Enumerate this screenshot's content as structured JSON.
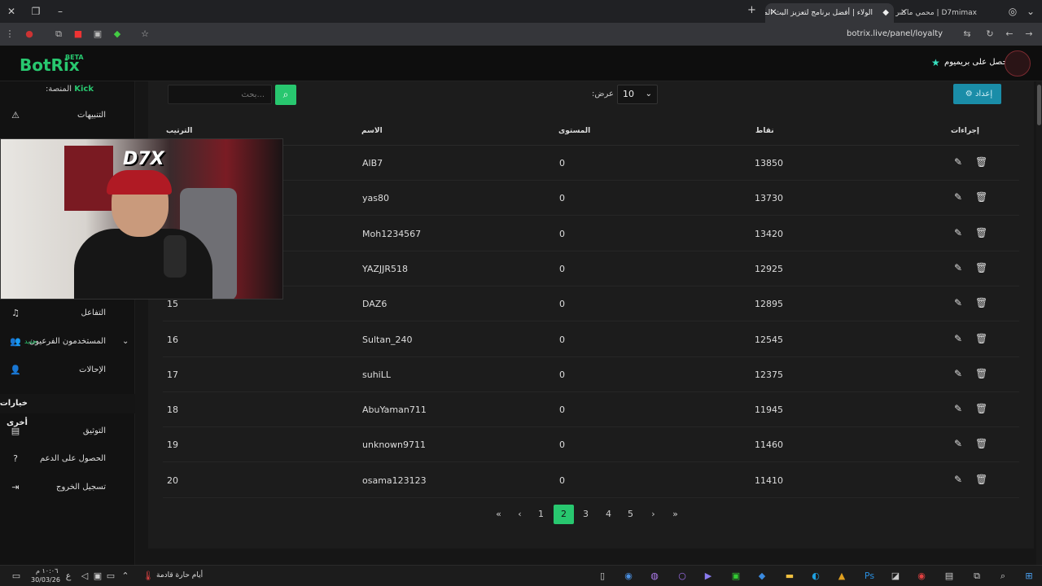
{
  "browser": {
    "tabs": [
      {
        "title": "الولاء | أفضل برنامج لتعزيز البث المباشر",
        "active": true
      },
      {
        "title": "D7mimax | محمي ماكس",
        "active": false
      }
    ],
    "url": "botrix.live/panel/loyalty"
  },
  "header": {
    "logo": "BotRix",
    "logo_badge": "BETA",
    "premium_label": "احصل على بريميوم"
  },
  "sidebar": {
    "platform_label": ":المنصة",
    "platform_value": "Kick",
    "items": [
      {
        "label": "التنبيهات",
        "icon": "warning-icon"
      },
      {
        "label": "التفاعل",
        "icon": "music-icon"
      },
      {
        "label": "المستخدمون الفرعيون",
        "icon": "users-icon",
        "badge": "جديد"
      },
      {
        "label": "الإحالات",
        "icon": "user-group-icon"
      }
    ],
    "other_header": "خيارات أخرى",
    "other_items": [
      {
        "label": "التوثيق",
        "icon": "book-icon"
      },
      {
        "label": "الحصول على الدعم",
        "icon": "help-icon"
      },
      {
        "label": "تسجيل الخروج",
        "icon": "logout-icon"
      }
    ]
  },
  "toolbar": {
    "setup_label": "إعداد",
    "show_label": ":عرض",
    "show_value": "10",
    "search_placeholder": "...بحث"
  },
  "table": {
    "headers": {
      "rank": "الترتيب",
      "name": "الاسم",
      "level": "المستوى",
      "points": "نقاط",
      "actions": "إجراءات"
    },
    "rows": [
      {
        "rank": "",
        "name": "AlB7",
        "level": "0",
        "points": "13850"
      },
      {
        "rank": "",
        "name": "yas80",
        "level": "0",
        "points": "13730"
      },
      {
        "rank": "",
        "name": "Moh1234567",
        "level": "0",
        "points": "13420"
      },
      {
        "rank": "",
        "name": "YAZJJR518",
        "level": "0",
        "points": "12925"
      },
      {
        "rank": "15",
        "name": "DAZ6",
        "level": "0",
        "points": "12895"
      },
      {
        "rank": "16",
        "name": "Sultan_240",
        "level": "0",
        "points": "12545"
      },
      {
        "rank": "17",
        "name": "suhiLL",
        "level": "0",
        "points": "12375"
      },
      {
        "rank": "18",
        "name": "AbuYaman711",
        "level": "0",
        "points": "11945"
      },
      {
        "rank": "19",
        "name": "unknown9711",
        "level": "0",
        "points": "11460"
      },
      {
        "rank": "20",
        "name": "osama123123",
        "level": "0",
        "points": "11410"
      }
    ]
  },
  "pagination": {
    "first": "«",
    "prev": "‹",
    "pages": [
      "1",
      "2",
      "3",
      "4",
      "5"
    ],
    "current": "2",
    "next": "›",
    "last": "»"
  },
  "taskbar": {
    "time": "١٠:٠٦ م",
    "date": "30/03/26",
    "weather": "أيام حارة قادمة"
  },
  "colors": {
    "accent": "#28c76f",
    "setup_button": "#1a8da8"
  }
}
